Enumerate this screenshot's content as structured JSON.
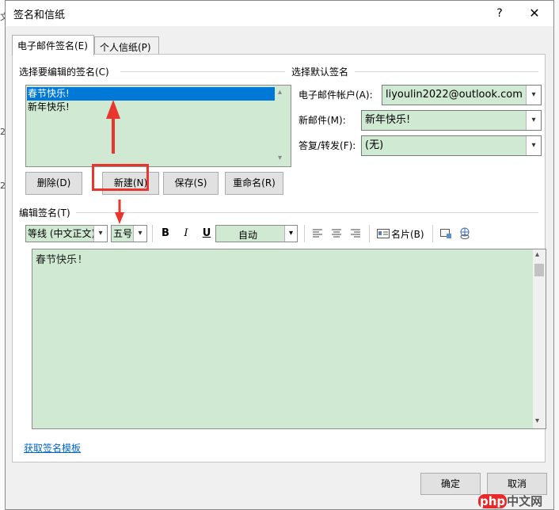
{
  "dialog": {
    "title": "签名和信纸",
    "help": "?",
    "close": "✕"
  },
  "tabs": [
    {
      "label": "电子邮件签名(E)"
    },
    {
      "label": "个人信纸(P)"
    }
  ],
  "edit_section": {
    "label": "选择要编辑的签名(C)",
    "signatures": [
      "春节快乐!",
      "新年快乐!"
    ],
    "buttons": {
      "delete": "删除(D)",
      "new": "新建(N)",
      "save": "保存(S)",
      "rename": "重命名(R)"
    }
  },
  "default_section": {
    "label": "选择默认签名",
    "account_label": "电子邮件帐户(A):",
    "account_value": "liyoulin2022@outlook.com",
    "new_message_label": "新邮件(M):",
    "new_message_value": "新年快乐!",
    "reply_label": "答复/转发(F):",
    "reply_value": "(无)"
  },
  "editor_section": {
    "label": "编辑签名(T)",
    "font": "等线 (中文正文)",
    "size": "五号",
    "bold": "B",
    "italic": "I",
    "underline": "U",
    "color": "自动",
    "business_card": "名片(B)",
    "content": "春节快乐!"
  },
  "template_link": "获取签名模板",
  "footer": {
    "ok": "确定",
    "cancel": "取消"
  },
  "watermark": {
    "brand": "php",
    "site": "中文网"
  },
  "background_fragments": [
    "文",
    "2",
    "2"
  ],
  "icons": {
    "down": "▾",
    "up": "▴",
    "align_left": "align-left-icon",
    "align_center": "align-center-icon",
    "align_right": "align-right-icon",
    "card": "business-card-icon",
    "picture": "insert-picture-icon",
    "link": "hyperlink-icon"
  },
  "colors": {
    "field_green": "#cfe9d3",
    "selection_blue": "#0078d7",
    "annotation_red": "#e8352d"
  }
}
